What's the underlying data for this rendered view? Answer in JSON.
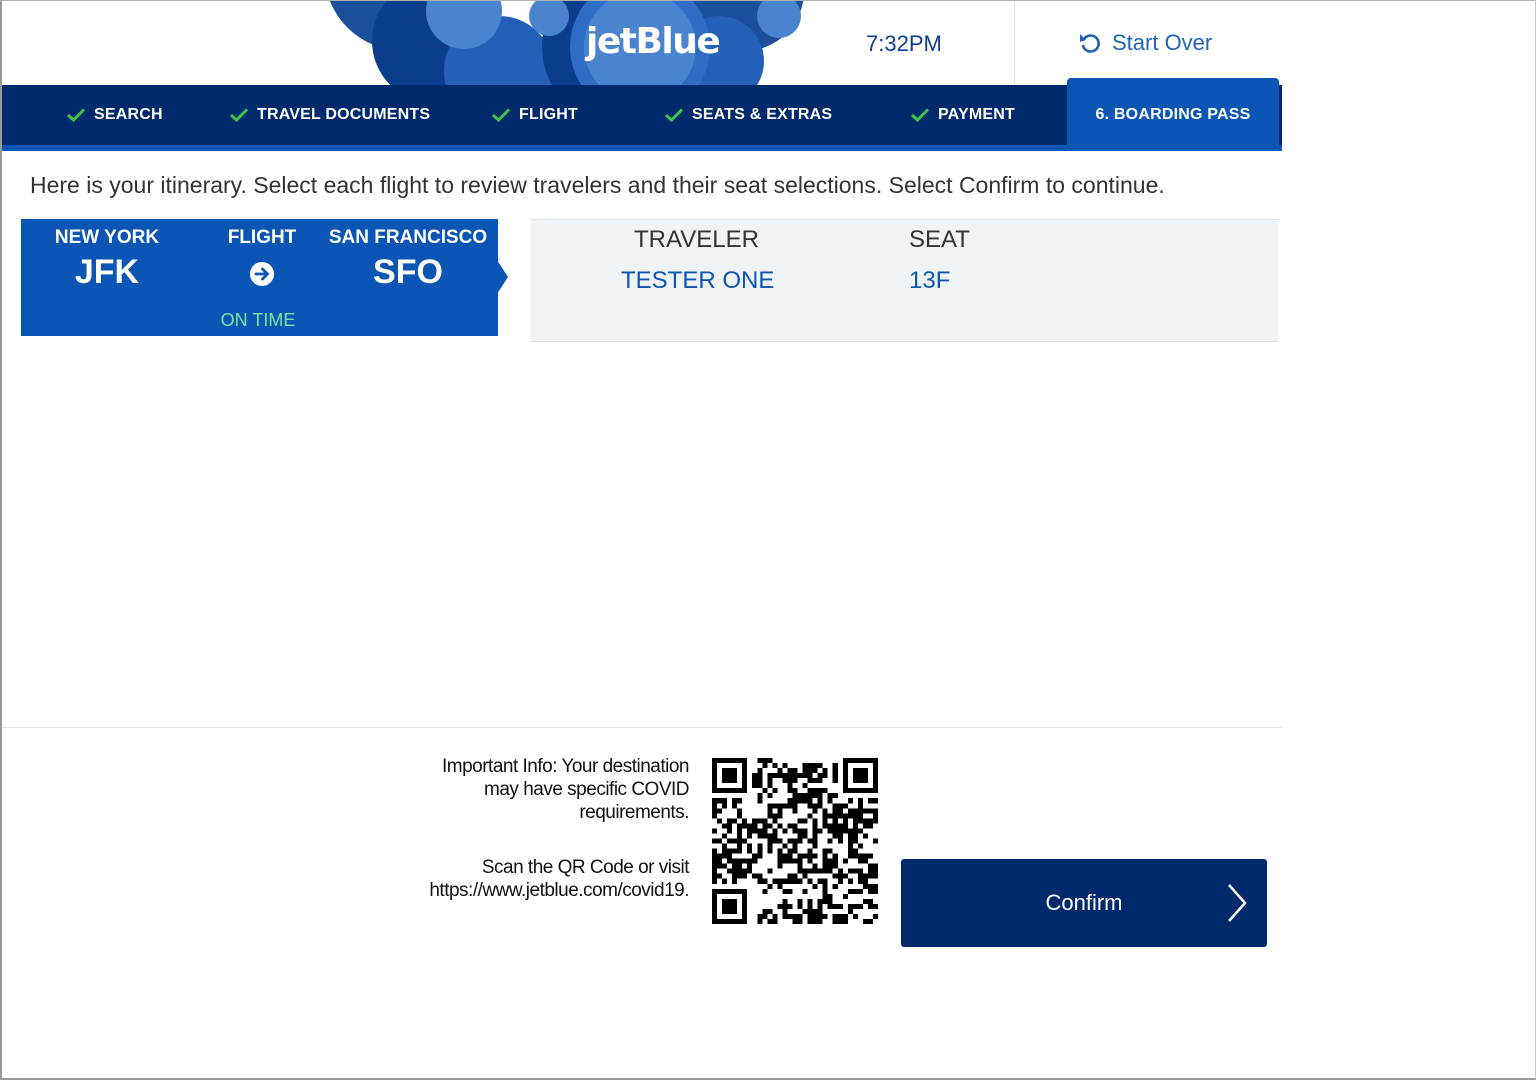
{
  "header": {
    "logo_text": "jetBlue",
    "time": "7:32PM",
    "start_over_label": "Start Over"
  },
  "nav": {
    "steps": [
      {
        "label": "SEARCH",
        "status": "complete"
      },
      {
        "label": "TRAVEL DOCUMENTS",
        "status": "complete"
      },
      {
        "label": "FLIGHT",
        "status": "complete"
      },
      {
        "label": "SEATS & EXTRAS",
        "status": "complete"
      },
      {
        "label": "PAYMENT",
        "status": "complete"
      },
      {
        "label": "6. BOARDING PASS",
        "status": "active"
      }
    ]
  },
  "instruction": "Here is your itinerary. Select each flight to review travelers and their seat selections. Select Confirm to continue.",
  "flight": {
    "origin_city": "NEW YORK",
    "origin_code": "JFK",
    "flight_label": "FLIGHT",
    "dest_city": "SAN FRANCISCO",
    "dest_code": "SFO",
    "status": "ON TIME"
  },
  "travelers": {
    "traveler_header": "TRAVELER",
    "seat_header": "SEAT",
    "rows": [
      {
        "name": "TESTER ONE",
        "seat": "13F"
      }
    ]
  },
  "footer": {
    "info_line1": "Important Info: Your destination",
    "info_line2": "may have specific COVID",
    "info_line3": "requirements.",
    "scan_line1": "Scan the QR Code or visit",
    "scan_line2": "https://www.jetblue.com/covid19.",
    "confirm_label": "Confirm"
  },
  "colors": {
    "nav_bg": "#002a6c",
    "accent_blue": "#0b56b5",
    "check_green": "#3fc24a",
    "on_time_green": "#7fe0a0"
  }
}
